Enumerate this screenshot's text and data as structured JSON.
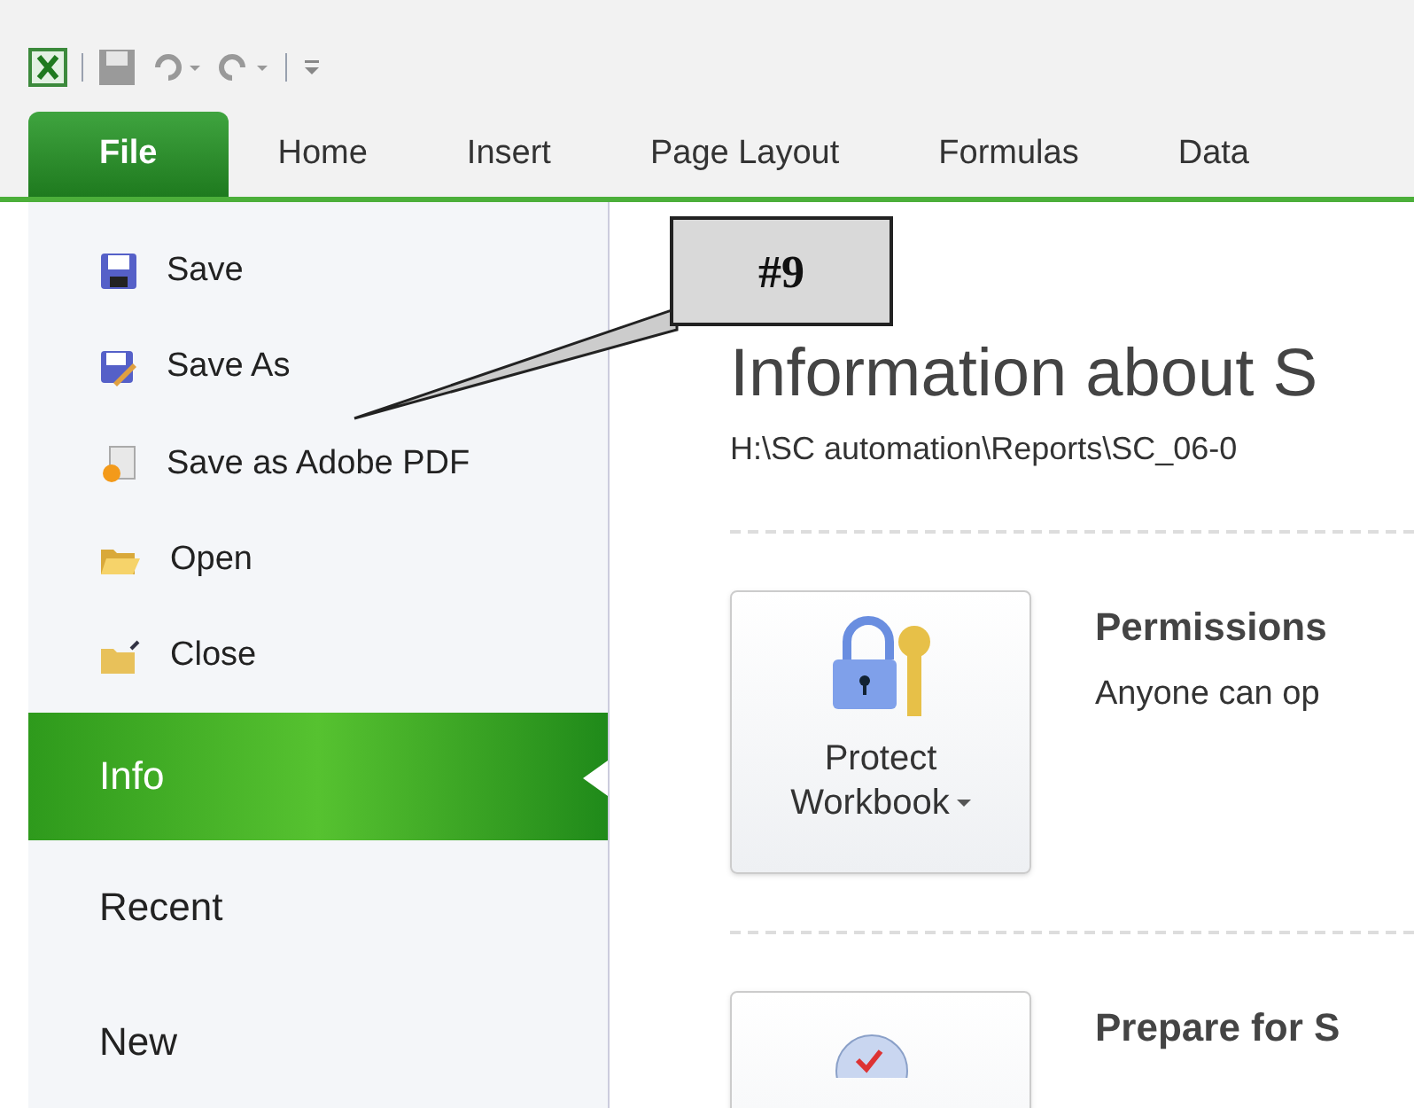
{
  "ribbon_tabs": [
    {
      "label": "File",
      "selected": true
    },
    {
      "label": "Home",
      "selected": false
    },
    {
      "label": "Insert",
      "selected": false
    },
    {
      "label": "Page Layout",
      "selected": false
    },
    {
      "label": "Formulas",
      "selected": false
    },
    {
      "label": "Data",
      "selected": false
    }
  ],
  "backstage_menu": [
    {
      "kind": "command",
      "label": "Save"
    },
    {
      "kind": "command",
      "label": "Save As"
    },
    {
      "kind": "command",
      "label": "Save as Adobe PDF"
    },
    {
      "kind": "command",
      "label": "Open"
    },
    {
      "kind": "command",
      "label": "Close"
    },
    {
      "kind": "page",
      "label": "Info",
      "selected": true
    },
    {
      "kind": "page",
      "label": "Recent",
      "selected": false
    },
    {
      "kind": "page",
      "label": "New",
      "selected": false
    }
  ],
  "info": {
    "title": "Information about S",
    "path": "H:\\SC automation\\Reports\\SC_06-0",
    "sections": [
      {
        "button": "Protect",
        "button_line2": "Workbook",
        "heading": "Permissions",
        "description": "Anyone can op"
      },
      {
        "heading": "Prepare for S"
      }
    ]
  },
  "callout": {
    "label": "#9"
  }
}
